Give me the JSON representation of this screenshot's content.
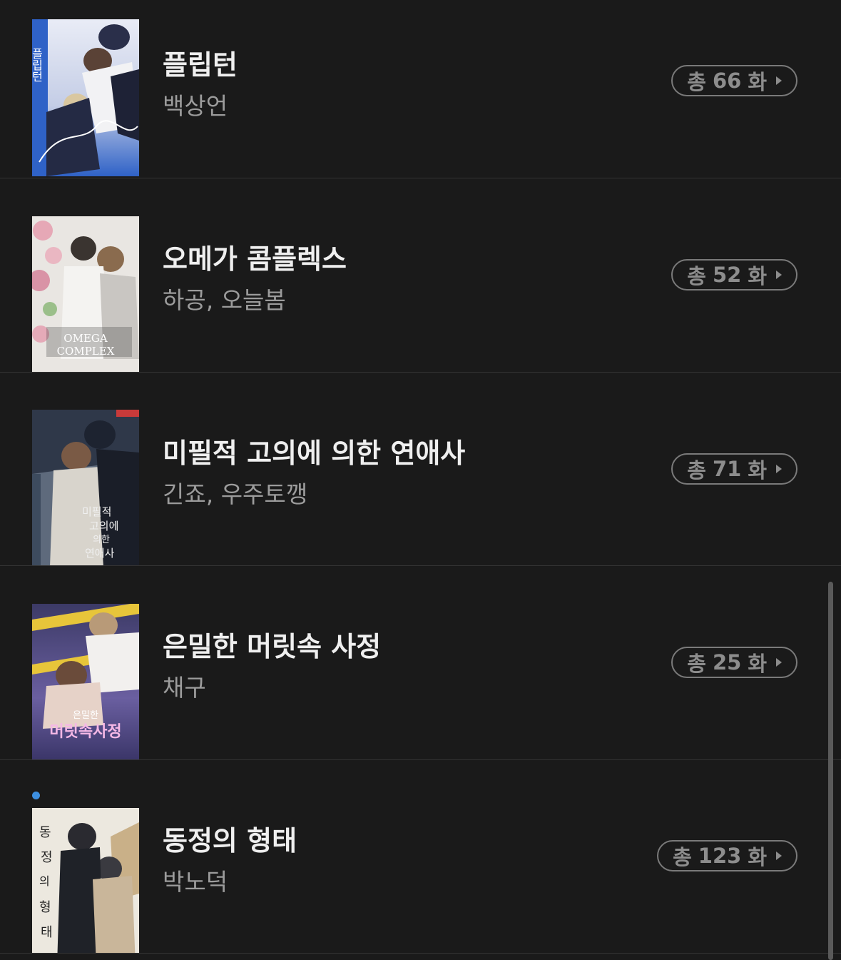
{
  "list": {
    "items": [
      {
        "title": "플립턴",
        "author": "백상언",
        "badge_prefix": "총",
        "episodes": "66",
        "badge_suffix": "화",
        "is_new": false,
        "cover_text": "플립턴",
        "cover_accent": "#3b6fd1"
      },
      {
        "title": "오메가 콤플렉스",
        "author": "하공, 오늘봄",
        "badge_prefix": "총",
        "episodes": "52",
        "badge_suffix": "화",
        "is_new": false,
        "cover_text": "OMEGA COMPLEX",
        "cover_accent": "#d9c9c9"
      },
      {
        "title": "미필적 고의에 의한 연애사",
        "author": "긴죠, 우주토깽",
        "badge_prefix": "총",
        "episodes": "71",
        "badge_suffix": "화",
        "is_new": false,
        "cover_text": "미필적 고의에 의한 연애사",
        "cover_accent": "#4b5668"
      },
      {
        "title": "은밀한 머릿속 사정",
        "author": "채구",
        "badge_prefix": "총",
        "episodes": "25",
        "badge_suffix": "화",
        "is_new": false,
        "cover_text": "은밀한 머릿속 사정",
        "cover_accent": "#5a4f8a"
      },
      {
        "title": "동정의 형태",
        "author": "박노덕",
        "badge_prefix": "총",
        "episodes": "123",
        "badge_suffix": "화",
        "is_new": true,
        "cover_text": "동정의 형태",
        "cover_accent": "#b8aa8c"
      }
    ]
  },
  "colors": {
    "background": "#1a1a1a",
    "title": "#efefef",
    "author": "#9c9c9c",
    "badge": "#8d8d8d",
    "new_dot": "#3d8fe0"
  }
}
